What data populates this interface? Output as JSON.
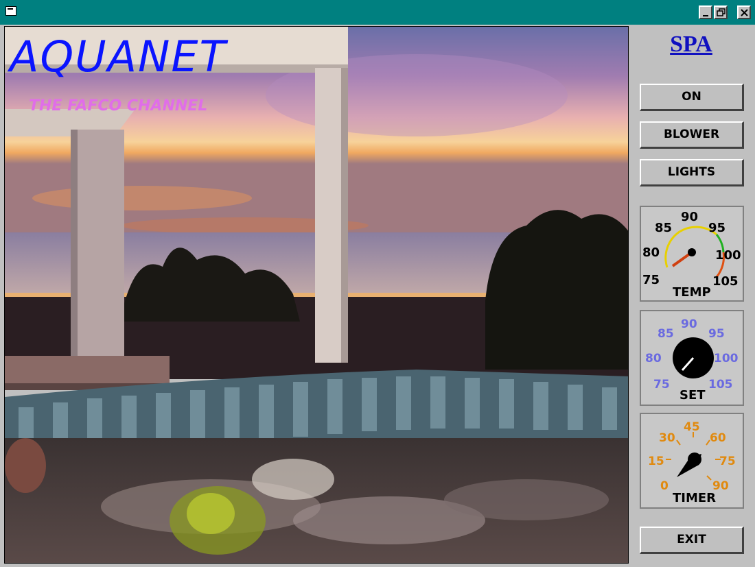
{
  "window": {
    "controls": [
      "minimize",
      "maximize",
      "close"
    ]
  },
  "logo": {
    "title": "AQUANET",
    "tagline": "THE FAFCO CHANNEL"
  },
  "panel": {
    "title": "SPA",
    "buttons": {
      "on": "ON",
      "blower": "BLOWER",
      "lights": "LIGHTS",
      "exit": "EXIT"
    },
    "temp_gauge": {
      "label": "TEMP",
      "ticks": [
        "75",
        "80",
        "85",
        "90",
        "95",
        "100",
        "105"
      ],
      "value": 78
    },
    "set_knob": {
      "label": "SET",
      "ticks": [
        "75",
        "80",
        "85",
        "90",
        "95",
        "100",
        "105"
      ],
      "value": 77
    },
    "timer_knob": {
      "label": "TIMER",
      "ticks": [
        "0",
        "15",
        "30",
        "45",
        "60",
        "75",
        "90"
      ],
      "value": 8
    }
  },
  "colors": {
    "titlebar": "#008080",
    "logo": "#0a14ff",
    "tagline": "#e06ee8",
    "spa_title": "#1010c0",
    "set_numbers": "#6a6ae0",
    "timer_numbers": "#e08a10"
  }
}
